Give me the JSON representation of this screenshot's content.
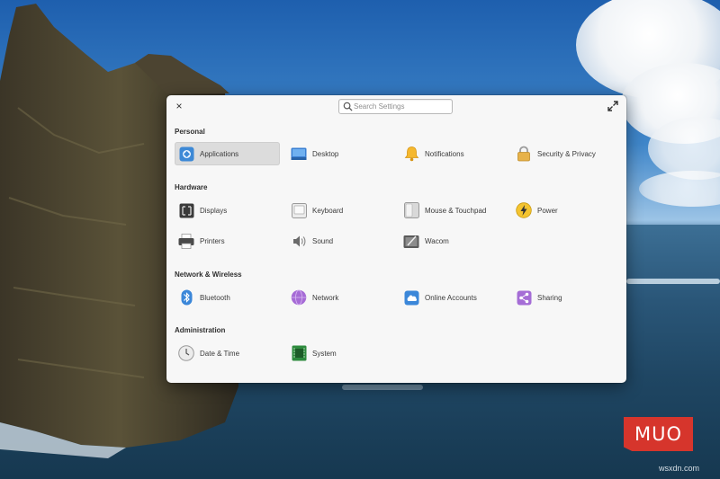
{
  "window": {
    "search_placeholder": "Search Settings",
    "close_glyph": "×"
  },
  "sections": [
    {
      "title": "Personal",
      "items": [
        {
          "label": "Applications",
          "icon": "applications-icon",
          "selected": true
        },
        {
          "label": "Desktop",
          "icon": "desktop-icon"
        },
        {
          "label": "Notifications",
          "icon": "notifications-bell-icon"
        },
        {
          "label": "Security & Privacy",
          "icon": "security-lock-icon"
        }
      ]
    },
    {
      "title": "Hardware",
      "items": [
        {
          "label": "Displays",
          "icon": "displays-icon"
        },
        {
          "label": "Keyboard",
          "icon": "keyboard-icon"
        },
        {
          "label": "Mouse & Touchpad",
          "icon": "mouse-touchpad-icon"
        },
        {
          "label": "Power",
          "icon": "power-bolt-icon"
        },
        {
          "label": "Printers",
          "icon": "printer-icon"
        },
        {
          "label": "Sound",
          "icon": "sound-speaker-icon"
        },
        {
          "label": "Wacom",
          "icon": "wacom-tablet-icon"
        }
      ]
    },
    {
      "title": "Network & Wireless",
      "items": [
        {
          "label": "Bluetooth",
          "icon": "bluetooth-icon"
        },
        {
          "label": "Network",
          "icon": "network-globe-icon"
        },
        {
          "label": "Online Accounts",
          "icon": "online-accounts-cloud-icon"
        },
        {
          "label": "Sharing",
          "icon": "sharing-icon"
        }
      ]
    },
    {
      "title": "Administration",
      "items": [
        {
          "label": "Date & Time",
          "icon": "date-time-clock-icon"
        },
        {
          "label": "System",
          "icon": "system-chip-icon"
        }
      ]
    }
  ],
  "brand": {
    "logo_text": "MUO",
    "watermark": "wsxdn.com",
    "logo_color": "#d6352c"
  }
}
